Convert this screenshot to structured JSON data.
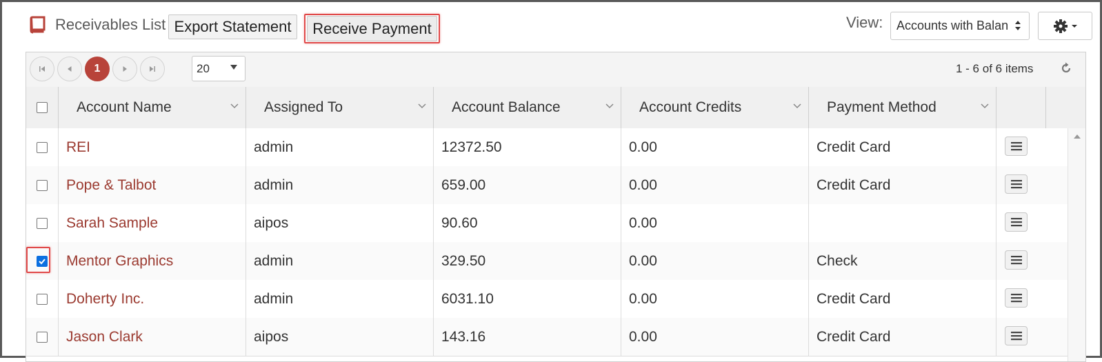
{
  "header": {
    "title": "Receivables List",
    "export_label": "Export Statement",
    "receive_label": "Receive Payment",
    "view_label": "View:",
    "view_value": "Accounts with Balan"
  },
  "pager": {
    "current_page": "1",
    "page_size": "20",
    "items_info": "1 - 6 of 6 items"
  },
  "columns": [
    "Account Name",
    "Assigned To",
    "Account Balance",
    "Account Credits",
    "Payment Method"
  ],
  "rows": [
    {
      "name": "REI",
      "assigned": "admin",
      "balance": "12372.50",
      "credits": "0.00",
      "method": "Credit Card",
      "checked": false
    },
    {
      "name": "Pope & Talbot",
      "assigned": "admin",
      "balance": "659.00",
      "credits": "0.00",
      "method": "Credit Card",
      "checked": false
    },
    {
      "name": "Sarah Sample",
      "assigned": "aipos",
      "balance": "90.60",
      "credits": "0.00",
      "method": "",
      "checked": false
    },
    {
      "name": "Mentor Graphics",
      "assigned": "admin",
      "balance": "329.50",
      "credits": "0.00",
      "method": "Check",
      "checked": true
    },
    {
      "name": "Doherty Inc.",
      "assigned": "admin",
      "balance": "6031.10",
      "credits": "0.00",
      "method": "Credit Card",
      "checked": false
    },
    {
      "name": "Jason Clark",
      "assigned": "aipos",
      "balance": "143.16",
      "credits": "0.00",
      "method": "Credit Card",
      "checked": false
    }
  ],
  "colors": {
    "accent": "#b8433a",
    "link": "#9b3a30",
    "highlight": "#e04848",
    "checkbox": "#0b6fe0"
  },
  "icons": {
    "title": "book-icon",
    "view_caret": "up-down-caret-icon",
    "settings": "gear-icon",
    "refresh": "refresh-icon",
    "row_menu": "hamburger-menu-icon"
  }
}
